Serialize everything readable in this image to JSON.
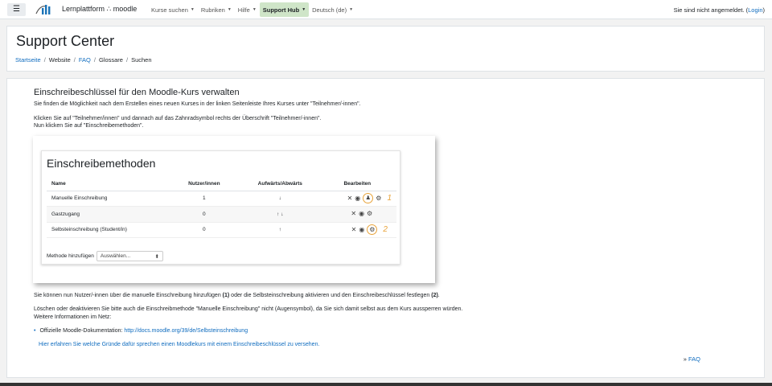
{
  "navbar": {
    "brand": "Lernplattform ∴ moodle",
    "items": [
      {
        "label": "Kurse suchen"
      },
      {
        "label": "Rubriken"
      },
      {
        "label": "Hilfe"
      },
      {
        "label": "Support Hub"
      },
      {
        "label": "Deutsch (de)"
      }
    ],
    "login_prefix": "Sie sind nicht angemeldet. (",
    "login_link": "Login",
    "login_suffix": ")"
  },
  "header": {
    "title": "Support Center",
    "breadcrumb": [
      "Startseite",
      "Website",
      "FAQ",
      "Glossare",
      "Suchen"
    ]
  },
  "main": {
    "heading": "Einschreibeschlüssel für den Moodle-Kurs verwalten",
    "p1": "Sie finden die Möglichkeit nach dem Erstellen eines neuen Kurses in der linken Seitenleiste Ihres Kurses unter \"Teilnehmer/-innen\".",
    "p2": "Klicken Sie auf \"Teilnehmer/innen\" und dannach auf das Zahnradsymbol rechts der Überschrift \"Teilnehmer/-innen\".",
    "p3": "Nun klicken Sie auf \"Einschreibemethoden\".",
    "p4a": "Sie können nun Nutzer/-innen über die manuelle Einschreibung hinzufügen ",
    "p4b": "(1)",
    "p4c": " oder die Selbsteinschreibung aktivieren und den Einschreibeschlüssel festlegen ",
    "p4d": "(2)",
    "p4e": ".",
    "p5": "Löschen oder deaktivieren Sie bitte auch die Einschreibmethode \"Manuelle Einschreibung\" nicht (Augensymbol), da Sie sich damit selbst aus dem Kurs aussperren würden.",
    "p6": "Weitere Informationen  im Netz:",
    "list_prefix": "Offizielle Moodle-Dokumentation: ",
    "list_link": "http://docs.moodle.org/39/de/Selbsteinschreibung",
    "more_link": "Hier erfahren Sie welche Gründe dafür sprechen einen Moodlekurs mit einem Einschreibeschlüssel zu versehen.",
    "faq_prefix": "» ",
    "faq_link": "FAQ"
  },
  "screenshot": {
    "title": "Einschreibemethoden",
    "columns": [
      "Name",
      "Nutzer/innen",
      "Aufwärts/Abwärts",
      "Bearbeiten"
    ],
    "rows": [
      {
        "name": "Manuelle Einschreibung",
        "users": "1",
        "arrows": "↓",
        "marker": "1"
      },
      {
        "name": "Gastzugang",
        "users": "0",
        "arrows": "↑ ↓",
        "marker": ""
      },
      {
        "name": "Selbsteinschreibung (Student/in)",
        "users": "0",
        "arrows": "↑",
        "marker": "2"
      }
    ],
    "add_label": "Methode hinzufügen",
    "select_value": "Auswählen..."
  },
  "colors": {
    "accent": "#0f6cbf",
    "active_nav": "#cfe5c8",
    "marker": "#e8a33a"
  }
}
